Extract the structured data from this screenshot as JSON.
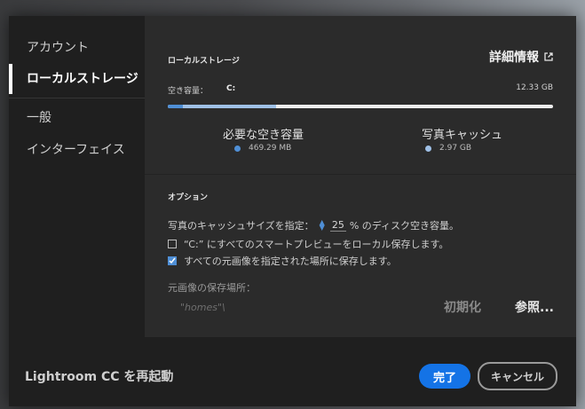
{
  "sidebar": {
    "items": [
      {
        "label": "アカウント"
      },
      {
        "label": "ローカルストレージ"
      },
      {
        "label": "一般"
      },
      {
        "label": "インターフェイス"
      }
    ]
  },
  "storage": {
    "title": "ローカルストレージ",
    "detail_link": "詳細情報",
    "free_label": "空き容量：",
    "drive": "C:",
    "total": "12.33 GB",
    "required_fraction": 0.04,
    "cache_fraction": 0.24,
    "required_label": "必要な空き容量",
    "required_value": "469.29 MB",
    "cache_label": "写真キャッシュ",
    "cache_value": "2.97 GB",
    "colors": {
      "required": "#4f8fd6",
      "cache": "#9fc0e6"
    }
  },
  "options": {
    "title": "オプション",
    "cache_prefix": "写真のキャッシュサイズを指定：",
    "cache_percent": "25",
    "cache_suffix": "% のディスク空き容量。",
    "smart_preview_label": "“C:” にすべてのスマートプレビューをローカル保存します。",
    "smart_preview_checked": false,
    "originals_label": "すべての元画像を指定された場所に保存します。",
    "originals_checked": true,
    "location_label": "元画像の保存場所：",
    "location_value": "\"homes\"\\",
    "reset_label": "初期化",
    "browse_label": "参照..."
  },
  "footer": {
    "restart_label": "Lightroom CC を再起動",
    "done_label": "完了",
    "cancel_label": "キャンセル"
  }
}
